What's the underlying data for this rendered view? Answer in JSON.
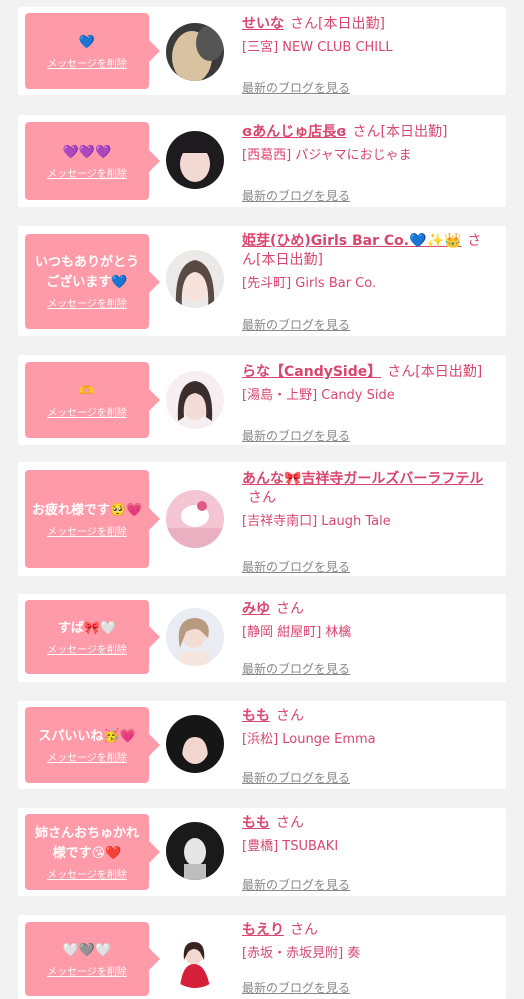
{
  "delete_label": "メッセージを削除",
  "san_label": "さん",
  "blog_label": "最新のブログを見る",
  "colors": {
    "bubble": "#ff9aa9",
    "accent": "#d9466e",
    "background": "#f2f2f2",
    "card": "#ffffff"
  },
  "items": [
    {
      "message": "💙",
      "name": "せいな",
      "status": "[本日出勤]",
      "shop": "[三宮] NEW CLUB CHILL",
      "avatar": "photo-blonde"
    },
    {
      "message": "💜💜💜",
      "name": "ɞあんじゅ店長ɞ",
      "status": "[本日出勤]",
      "shop": "[西葛西] パジャマにおじゃま",
      "avatar": "photo-dark-hair"
    },
    {
      "message": "いつもありがとうございます💙",
      "name": "姫芽(ひめ)Girls Bar Co.💙✨👑",
      "status": "[本日出勤]",
      "shop": "[先斗町] Girls Bar Co.",
      "avatar": "photo-bangs"
    },
    {
      "message": "🫶",
      "name": "らな【CandySide】",
      "status": "[本日出勤]",
      "shop": "[湯島・上野] Candy Side",
      "avatar": "photo-pink"
    },
    {
      "message": "お疲れ様です🥺💗",
      "name": "あんな🎀吉祥寺ガールズバーラフテル",
      "status": "",
      "shop": "[吉祥寺南口] Laugh Tale",
      "avatar": "photo-kitty"
    },
    {
      "message": "すば🎀🤍",
      "name": "みゆ",
      "status": "",
      "shop": "[静岡 紺屋町] 林檎",
      "avatar": "photo-light"
    },
    {
      "message": "スパいいね🥳💗",
      "name": "もも",
      "status": "",
      "shop": "[浜松] Lounge Emma",
      "avatar": "photo-dark-hair-2"
    },
    {
      "message": "姉さんおちゅかれ様です😘❤️",
      "name": "もも",
      "status": "",
      "shop": "[豊橋] TSUBAKI",
      "avatar": "photo-mono"
    },
    {
      "message": "🤍🩶🤍",
      "name": "もえり",
      "status": "",
      "shop": "[赤坂・赤坂見附] 奏",
      "avatar": "photo-red-dress"
    }
  ]
}
